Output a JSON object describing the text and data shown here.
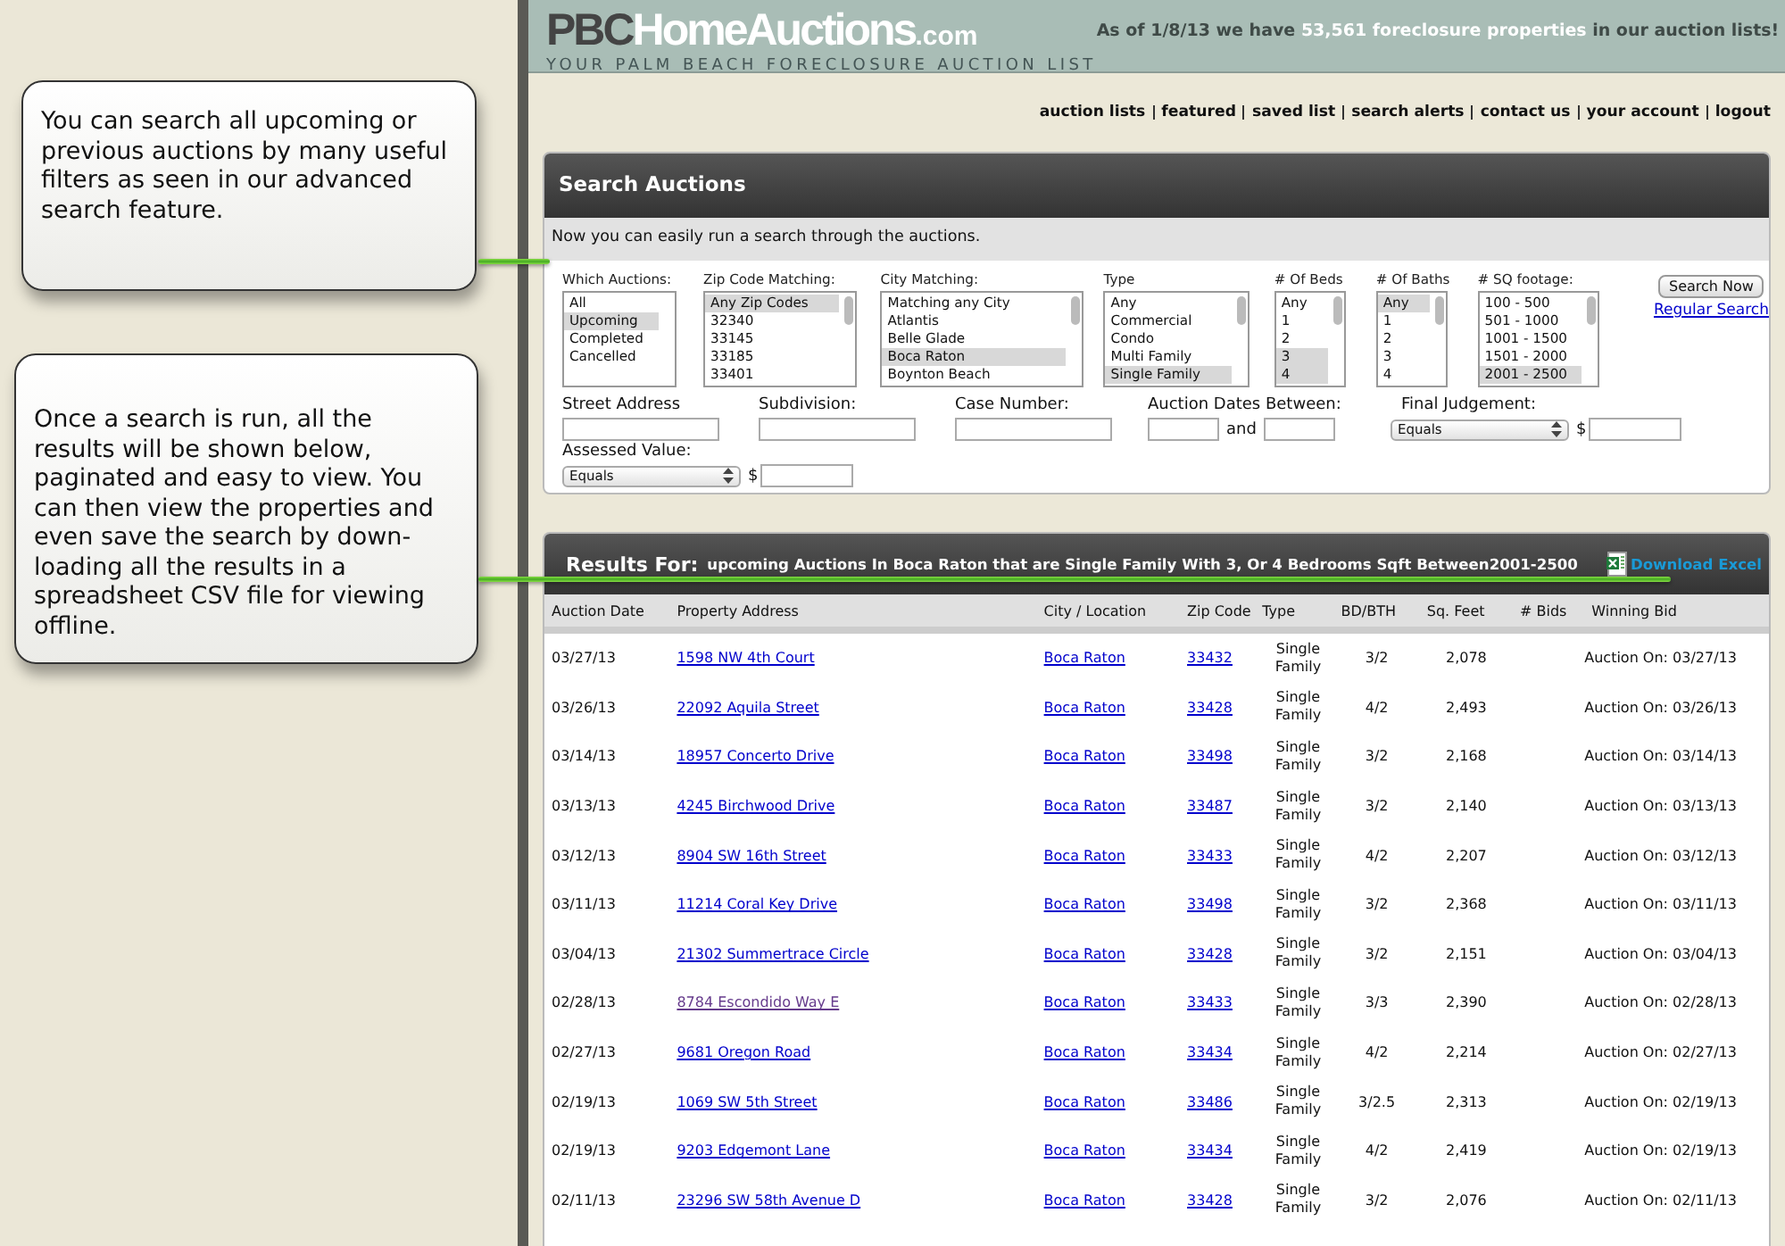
{
  "callouts": [
    {
      "text": "You can search all upcoming or previous auctions by many useful filters as seen in our advanced search feature."
    },
    {
      "text": "Once a search is run, all the results will be shown below, paginated and easy to view.  You can then view the properties and even save the search by down-loading all the results in a spreadsheet CSV file for viewing offline."
    }
  ],
  "header": {
    "logo": {
      "prefix": "PBC",
      "name": "HomeAuctions",
      "suffix": ".com"
    },
    "tagline": "YOUR PALM BEACH FORECLOSURE AUCTION LIST",
    "notice": "As of 1/8/13 we have **53,561 foreclosure properties** in our auction lists!"
  },
  "nav": [
    "auction lists",
    "featured",
    "saved list",
    "search alerts",
    "contact us",
    "your account",
    "logout"
  ],
  "search": {
    "title": "Search Auctions",
    "intro": "Now you can easily run a search through the auctions.",
    "lists": [
      {
        "label": "Which Auctions:",
        "options": [
          {
            "text": "All",
            "selected": false
          },
          {
            "text": "Upcoming",
            "selected": true
          },
          {
            "text": "Completed",
            "selected": false
          },
          {
            "text": "Cancelled",
            "selected": false
          }
        ]
      },
      {
        "label": "Zip Code Matching:",
        "options": [
          {
            "text": "Any Zip Codes",
            "selected": true
          },
          {
            "text": "32340",
            "selected": false
          },
          {
            "text": "33145",
            "selected": false
          },
          {
            "text": "33185",
            "selected": false
          },
          {
            "text": "33401",
            "selected": false
          }
        ]
      },
      {
        "label": "City Matching:",
        "options": [
          {
            "text": "Matching any City",
            "selected": false
          },
          {
            "text": "Atlantis",
            "selected": false
          },
          {
            "text": "Belle Glade",
            "selected": false
          },
          {
            "text": "Boca Raton",
            "selected": true
          },
          {
            "text": "Boynton Beach",
            "selected": false
          }
        ]
      },
      {
        "label": "Type",
        "options": [
          {
            "text": "Any",
            "selected": false
          },
          {
            "text": "Commercial",
            "selected": false
          },
          {
            "text": "Condo",
            "selected": false
          },
          {
            "text": "Multi Family",
            "selected": false
          },
          {
            "text": "Single Family",
            "selected": true
          }
        ]
      },
      {
        "label": "# Of Beds",
        "options": [
          {
            "text": "Any",
            "selected": false
          },
          {
            "text": "1",
            "selected": false
          },
          {
            "text": "2",
            "selected": false
          },
          {
            "text": "3",
            "selected": true
          },
          {
            "text": "4",
            "selected": true
          }
        ]
      },
      {
        "label": "# Of Baths",
        "options": [
          {
            "text": "Any",
            "selected": true
          },
          {
            "text": "1",
            "selected": false
          },
          {
            "text": "2",
            "selected": false
          },
          {
            "text": "3",
            "selected": false
          },
          {
            "text": "4",
            "selected": false
          }
        ]
      },
      {
        "label": "# SQ footage:",
        "options": [
          {
            "text": "100 - 500",
            "selected": false
          },
          {
            "text": "501 - 1000",
            "selected": false
          },
          {
            "text": "1001 - 1500",
            "selected": false
          },
          {
            "text": "1501 - 2000",
            "selected": false
          },
          {
            "text": "2001 - 2500",
            "selected": true
          }
        ]
      }
    ],
    "search_button": "Search Now",
    "regular_search": "Regular Search",
    "fields": {
      "street_address": "Street Address",
      "subdivision": "Subdivision:",
      "case_number": "Case Number:",
      "auction_dates": "Auction Dates Between:",
      "and": "and",
      "final_judgement": "Final Judgement:",
      "final_judgement_operator": "Equals",
      "currency": "$",
      "assessed_value": "Assessed Value:",
      "assessed_value_operator": "Equals",
      "assessed_currency": "$"
    }
  },
  "results": {
    "label": "Results For:",
    "query": "upcoming Auctions In Boca Raton that are Single Family With 3, Or 4 Bedrooms Sqft Between2001-2500",
    "download": "Download Excel",
    "columns": [
      "Auction Date",
      "Property Address",
      "City / Location",
      "Zip Code",
      "Type",
      "BD/BTH",
      "Sq. Feet",
      "# Bids",
      "Winning Bid"
    ],
    "rows": [
      {
        "date": "03/27/13",
        "address": "1598 NW 4th Court",
        "visited": false,
        "city": "Boca Raton",
        "zip": "33432",
        "type": "Single Family",
        "bd_bth": "3/2",
        "sq_feet": "2,078",
        "bids": "",
        "winning_bid": "Auction On: 03/27/13"
      },
      {
        "date": "03/26/13",
        "address": "22092 Aquila Street",
        "visited": false,
        "city": "Boca Raton",
        "zip": "33428",
        "type": "Single Family",
        "bd_bth": "4/2",
        "sq_feet": "2,493",
        "bids": "",
        "winning_bid": "Auction On: 03/26/13"
      },
      {
        "date": "03/14/13",
        "address": "18957 Concerto Drive",
        "visited": false,
        "city": "Boca Raton",
        "zip": "33498",
        "type": "Single Family",
        "bd_bth": "3/2",
        "sq_feet": "2,168",
        "bids": "",
        "winning_bid": "Auction On: 03/14/13"
      },
      {
        "date": "03/13/13",
        "address": "4245 Birchwood Drive",
        "visited": false,
        "city": "Boca Raton",
        "zip": "33487",
        "type": "Single Family",
        "bd_bth": "3/2",
        "sq_feet": "2,140",
        "bids": "",
        "winning_bid": "Auction On: 03/13/13"
      },
      {
        "date": "03/12/13",
        "address": "8904 SW 16th Street",
        "visited": false,
        "city": "Boca Raton",
        "zip": "33433",
        "type": "Single Family",
        "bd_bth": "4/2",
        "sq_feet": "2,207",
        "bids": "",
        "winning_bid": "Auction On: 03/12/13"
      },
      {
        "date": "03/11/13",
        "address": "11214 Coral Key Drive",
        "visited": false,
        "city": "Boca Raton",
        "zip": "33498",
        "type": "Single Family",
        "bd_bth": "3/2",
        "sq_feet": "2,368",
        "bids": "",
        "winning_bid": "Auction On: 03/11/13"
      },
      {
        "date": "03/04/13",
        "address": "21302 Summertrace Circle",
        "visited": false,
        "city": "Boca Raton",
        "zip": "33428",
        "type": "Single Family",
        "bd_bth": "3/2",
        "sq_feet": "2,151",
        "bids": "",
        "winning_bid": "Auction On: 03/04/13"
      },
      {
        "date": "02/28/13",
        "address": "8784 Escondido Way E",
        "visited": true,
        "city": "Boca Raton",
        "zip": "33433",
        "type": "Single Family",
        "bd_bth": "3/3",
        "sq_feet": "2,390",
        "bids": "",
        "winning_bid": "Auction On: 02/28/13"
      },
      {
        "date": "02/27/13",
        "address": "9681 Oregon Road",
        "visited": false,
        "city": "Boca Raton",
        "zip": "33434",
        "type": "Single Family",
        "bd_bth": "4/2",
        "sq_feet": "2,214",
        "bids": "",
        "winning_bid": "Auction On: 02/27/13"
      },
      {
        "date": "02/19/13",
        "address": "1069 SW 5th Street",
        "visited": false,
        "city": "Boca Raton",
        "zip": "33486",
        "type": "Single Family",
        "bd_bth": "3/2.5",
        "sq_feet": "2,313",
        "bids": "",
        "winning_bid": "Auction On: 02/19/13"
      },
      {
        "date": "02/19/13",
        "address": "9203 Edgemont Lane",
        "visited": false,
        "city": "Boca Raton",
        "zip": "33434",
        "type": "Single Family",
        "bd_bth": "4/2",
        "sq_feet": "2,419",
        "bids": "",
        "winning_bid": "Auction On: 02/19/13"
      },
      {
        "date": "02/11/13",
        "address": "23296 SW 58th Avenue D",
        "visited": false,
        "city": "Boca Raton",
        "zip": "33428",
        "type": "Single Family",
        "bd_bth": "3/2",
        "sq_feet": "2,076",
        "bids": "",
        "winning_bid": "Auction On: 02/11/13"
      }
    ]
  }
}
